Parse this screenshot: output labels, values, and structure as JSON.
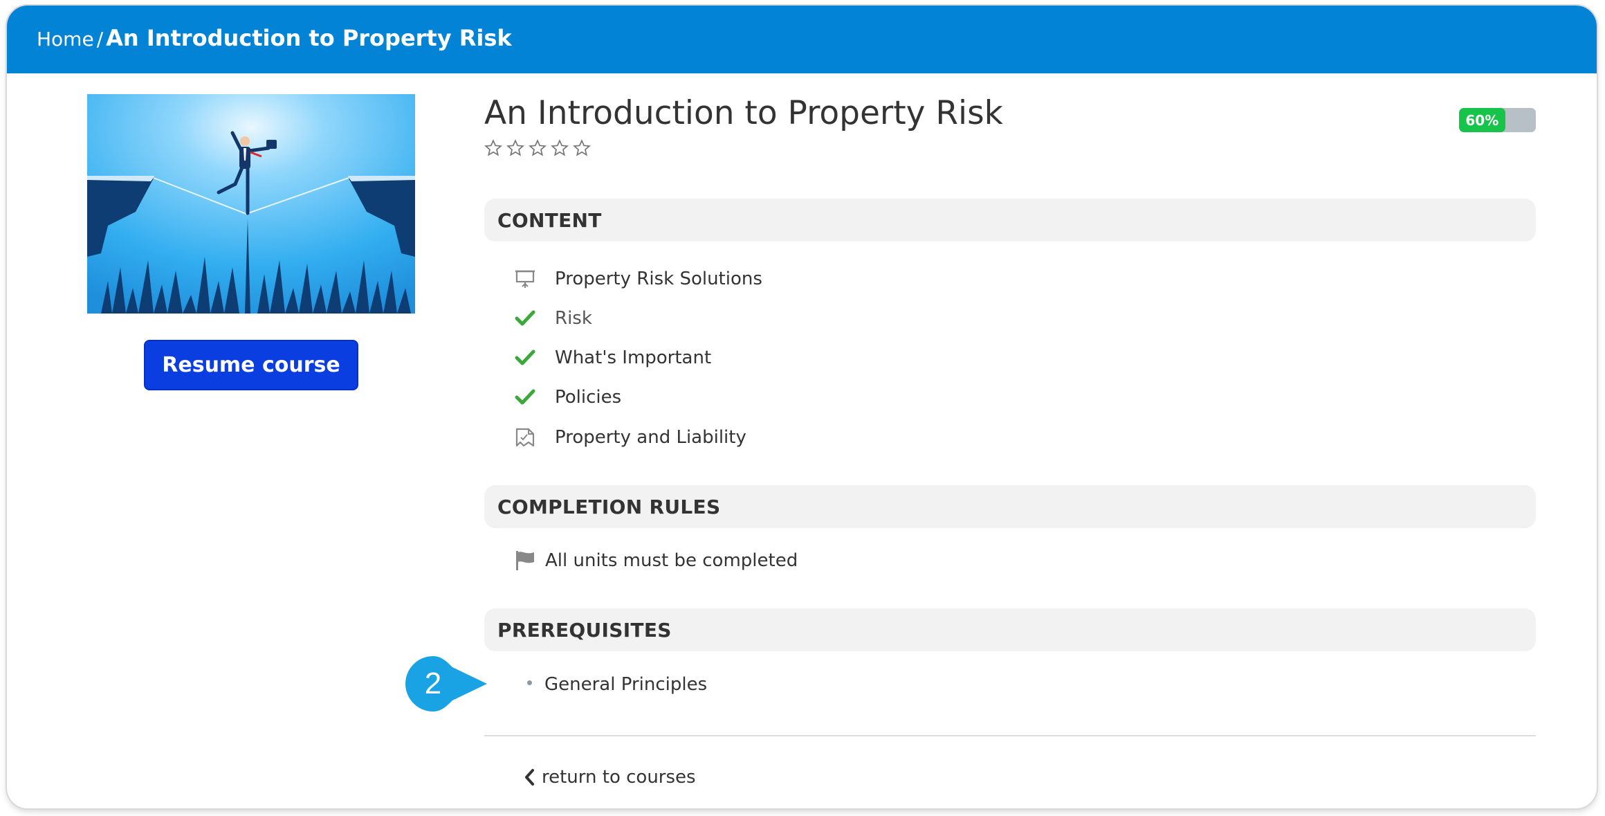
{
  "breadcrumb": {
    "home": "Home",
    "separator": "/",
    "current": "An Introduction to Property Risk"
  },
  "course": {
    "title": "An Introduction to Property Risk",
    "rating_stars": 5,
    "rating_value": 0,
    "progress_percent": 60,
    "progress_label": "60%",
    "image_icon": "businessman-tightrope-illustration",
    "resume_label": "Resume course"
  },
  "content": {
    "header": "CONTENT",
    "units": [
      {
        "label": "Property Risk Solutions",
        "icon": "presentation-icon",
        "completed": false
      },
      {
        "label": "Risk",
        "icon": "check-icon",
        "completed": true
      },
      {
        "label": "What's Important",
        "icon": "check-icon",
        "completed": true
      },
      {
        "label": "Policies",
        "icon": "check-icon",
        "completed": true
      },
      {
        "label": "Property and Liability",
        "icon": "document-icon",
        "completed": false
      }
    ]
  },
  "completion_rules": {
    "header": "COMPLETION RULES",
    "rules": [
      {
        "label": "All units must be completed",
        "icon": "flag-icon"
      }
    ]
  },
  "prerequisites": {
    "header": "PREREQUISITES",
    "items": [
      {
        "label": "General Principles"
      }
    ]
  },
  "callout": {
    "number": "2"
  },
  "footer": {
    "return_label": "return to courses"
  },
  "colors": {
    "header_bg": "#0283d6",
    "button_bg": "#0a3ee0",
    "progress_fill": "#16c44a",
    "progress_track": "#b8c0c7",
    "check": "#3aa83a",
    "callout": "#1aa3e4"
  }
}
